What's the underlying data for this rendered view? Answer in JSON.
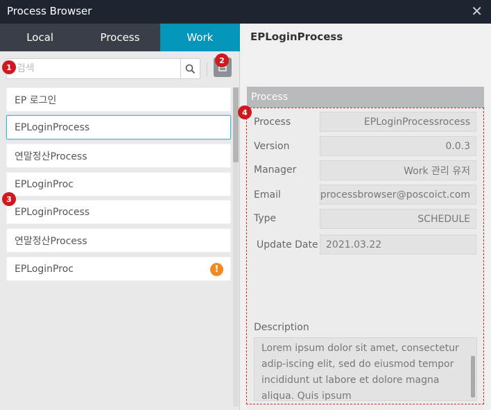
{
  "window": {
    "title": "Process Browser"
  },
  "tabs": [
    {
      "label": "Local"
    },
    {
      "label": "Process"
    },
    {
      "label": "Work"
    }
  ],
  "search": {
    "placeholder": "검색",
    "value": ""
  },
  "process_list": [
    {
      "label": "EP 로그인",
      "selected": false,
      "warning": false
    },
    {
      "label": "EPLoginProcess",
      "selected": true,
      "warning": false
    },
    {
      "label": "연말정산Process",
      "selected": false,
      "warning": false
    },
    {
      "label": "EPLoginProc",
      "selected": false,
      "warning": false
    },
    {
      "label": "EPLoginProcess",
      "selected": false,
      "warning": false
    },
    {
      "label": "연말정산Process",
      "selected": false,
      "warning": false
    },
    {
      "label": "EPLoginProc",
      "selected": false,
      "warning": true,
      "warning_glyph": "!"
    }
  ],
  "detail": {
    "title": "EPLoginProcess",
    "section_label": "Process",
    "fields": [
      {
        "label": "Process",
        "value": "EPLoginProcessrocess"
      },
      {
        "label": "Version",
        "value": "0.0.3"
      },
      {
        "label": "Manager",
        "value": "Work 관리 유저"
      },
      {
        "label": "Email",
        "value": "processbrowser@poscoict.com"
      },
      {
        "label": "Type",
        "value": "SCHEDULE"
      },
      {
        "label": "Update Date",
        "value": "2021.03.22"
      }
    ],
    "description_label": "Description",
    "description": "Lorem ipsum dolor sit amet, consectetur adip-iscing elit, sed do eiusmod tempor incididunt ut labore et dolore magna aliqua. Quis ipsum"
  },
  "annotations": [
    "1",
    "2",
    "3",
    "4"
  ],
  "colors": {
    "active_tab": "#0595b9",
    "titlebar": "#1e2430",
    "tabbar": "#3a3f47",
    "warning": "#f08a24",
    "annotation": "#d0191f"
  },
  "icons": {
    "close": "close-icon",
    "search": "search-icon",
    "filter": "archive-icon",
    "warning": "warning-icon"
  }
}
